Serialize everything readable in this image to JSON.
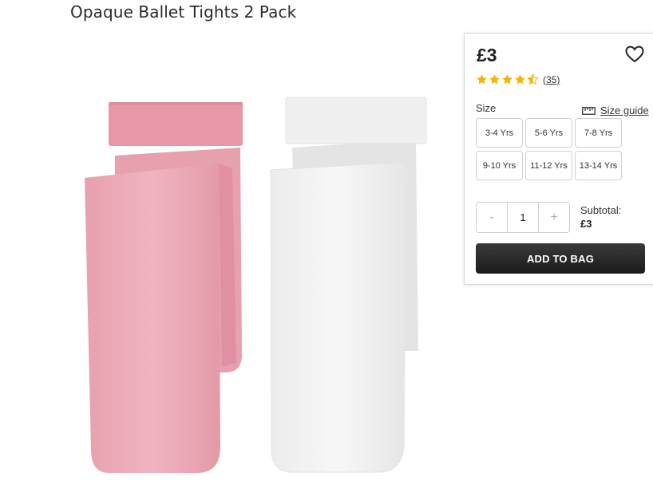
{
  "product": {
    "title": "Opaque Ballet Tights 2 Pack",
    "image_icon": "tights-product-image"
  },
  "purchase": {
    "price": "£3",
    "wishlist_icon": "heart-icon",
    "rating": {
      "stars": 4.5,
      "max_stars": 5,
      "count": "(35)",
      "star_color": "#f5b301"
    },
    "size_label": "Size",
    "size_guide_label": "Size guide",
    "size_guide_icon": "ruler-icon",
    "sizes": [
      {
        "label": "3-4 Yrs"
      },
      {
        "label": "5-6 Yrs"
      },
      {
        "label": "7-8 Yrs"
      },
      {
        "label": "9-10 Yrs"
      },
      {
        "label": "11-12 Yrs"
      },
      {
        "label": "13-14 Yrs"
      }
    ],
    "quantity": {
      "decrement": "-",
      "value": "1",
      "increment": "+"
    },
    "subtotal_label": "Subtotal:",
    "subtotal_value": "£3",
    "add_to_bag": "ADD TO BAG"
  }
}
